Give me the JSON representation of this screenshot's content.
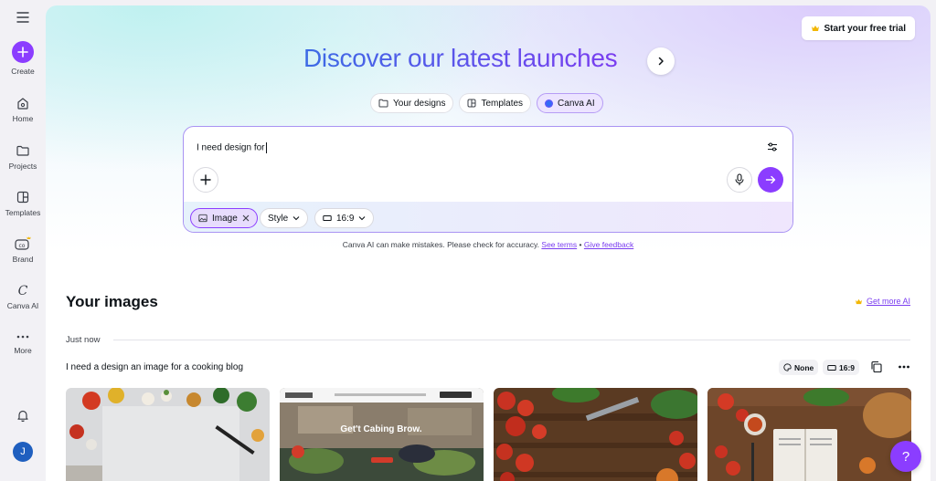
{
  "sidebar": {
    "items": [
      {
        "label": "Create",
        "icon": "plus-icon"
      },
      {
        "label": "Home",
        "icon": "home-icon"
      },
      {
        "label": "Projects",
        "icon": "folder-icon"
      },
      {
        "label": "Templates",
        "icon": "templates-icon"
      },
      {
        "label": "Brand",
        "icon": "brand-icon"
      },
      {
        "label": "Canva AI",
        "icon": "canva-ai-icon"
      },
      {
        "label": "More",
        "icon": "more-icon"
      }
    ],
    "avatar_initial": "J"
  },
  "header": {
    "trial_label": "Start your free trial",
    "headline": "Discover our latest launches"
  },
  "mode_tabs": [
    {
      "label": "Your designs",
      "active": false
    },
    {
      "label": "Templates",
      "active": false
    },
    {
      "label": "Canva AI",
      "active": true
    }
  ],
  "prompt": {
    "text": "I need design for",
    "chips": {
      "image": "Image",
      "style": "Style",
      "ratio": "16:9"
    }
  },
  "disclaimer": {
    "text": "Canva AI can make mistakes. Please check for accuracy.",
    "see_terms": "See terms",
    "separator": "•",
    "give_feedback": "Give feedback"
  },
  "images_section": {
    "title": "Your images",
    "get_more": "Get more AI",
    "group_label": "Just now",
    "generation_prompt": "I need a design an image for a cooking blog",
    "style_tag": "None",
    "ratio_tag": "16:9",
    "thumb2_heading": "Get't Cabing Brow."
  },
  "help_label": "?",
  "colors": {
    "accent": "#8b3dff",
    "headline_start": "#3d6be5",
    "headline_end": "#7a3df0"
  }
}
